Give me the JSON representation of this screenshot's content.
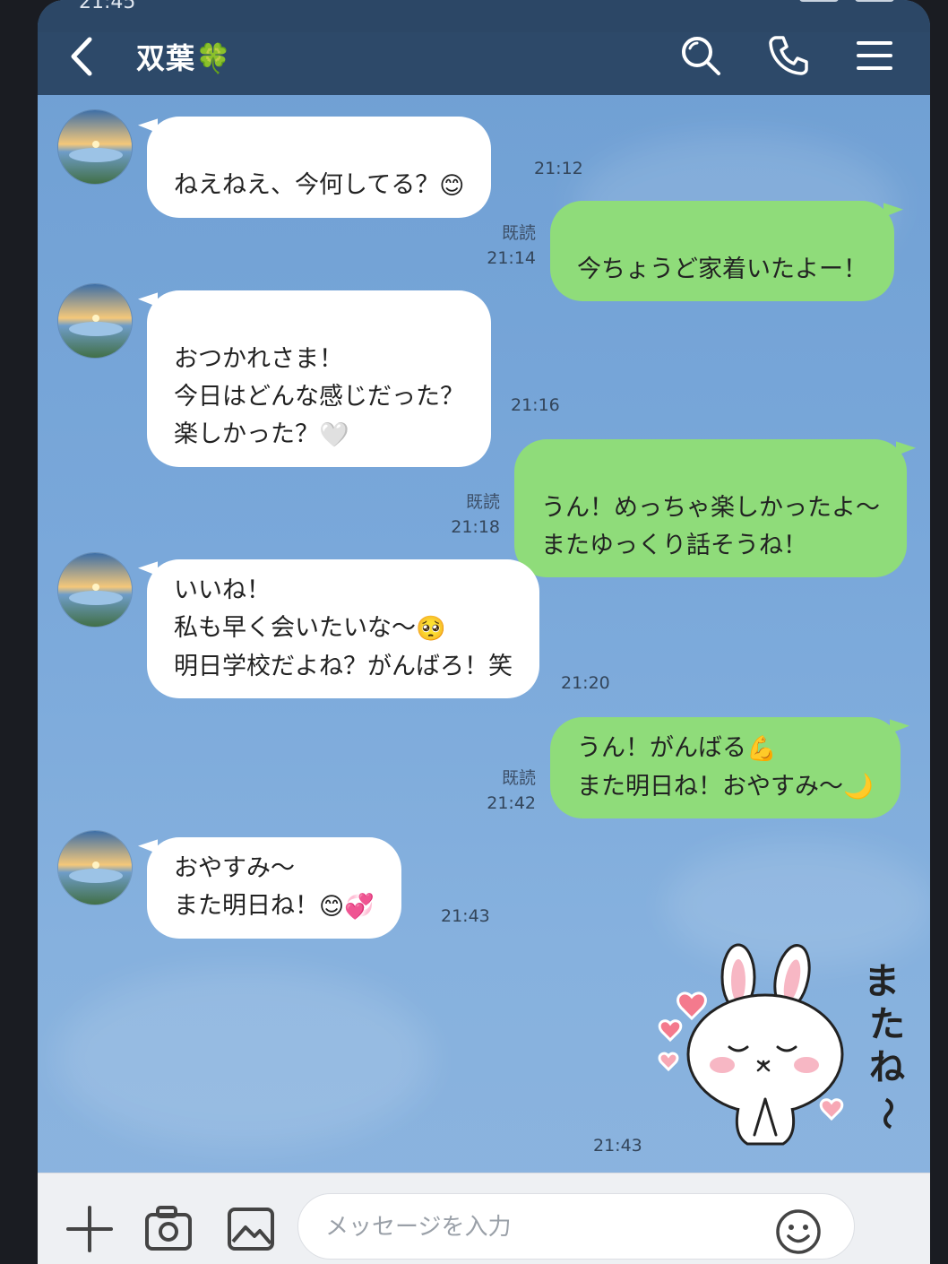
{
  "statusbar": {
    "time": "21:45"
  },
  "header": {
    "title": "双葉🍀",
    "back_icon": "chevron-left-icon",
    "search_icon": "search-icon",
    "call_icon": "phone-icon",
    "menu_icon": "menu-icon"
  },
  "messages": [
    {
      "from": "friend",
      "text": "ねえねえ、今何してる？",
      "emoji": "😊",
      "time": "21:12"
    },
    {
      "from": "me",
      "text": "今ちょうど家着いたよー！",
      "read": "既読",
      "time": "21:14"
    },
    {
      "from": "friend",
      "text": "おつかれさま！\n今日はどんな感じだった？\n楽しかった？",
      "emoji": "🤍",
      "time": "21:16"
    },
    {
      "from": "me",
      "text": "うん！めっちゃ楽しかったよ〜\nまたゆっくり話そうね！",
      "read": "既読",
      "time": "21:18"
    },
    {
      "from": "friend",
      "line1": "いいね！",
      "line2": "私も早く会いたいな〜",
      "line2_emoji": "🥺",
      "line3": "明日学校だよね？がんばろ！笑",
      "time": "21:20"
    },
    {
      "from": "me",
      "line1": "うん！がんばる",
      "line1_emoji": "💪",
      "line2": "また明日ね！おやすみ〜",
      "line2_emoji": "🌙",
      "read": "既読",
      "time": "21:42"
    },
    {
      "from": "friend",
      "line1": "おやすみ〜",
      "line2": "また明日ね！",
      "line2_emoji": "😊💞",
      "time": "21:43"
    },
    {
      "from": "me",
      "sticker": "bunny-sticker",
      "sticker_text": "またね〜",
      "time": "21:43"
    }
  ],
  "inputbar": {
    "placeholder": "メッセージを入力",
    "plus_icon": "plus-icon",
    "camera_icon": "camera-icon",
    "image_icon": "image-icon",
    "emoji_icon": "smile-icon"
  },
  "colors": {
    "header": "#2d4969",
    "outgoing_bubble": "#8fdc7a",
    "incoming_bubble": "#ffffff",
    "background": "#7aa8da"
  }
}
